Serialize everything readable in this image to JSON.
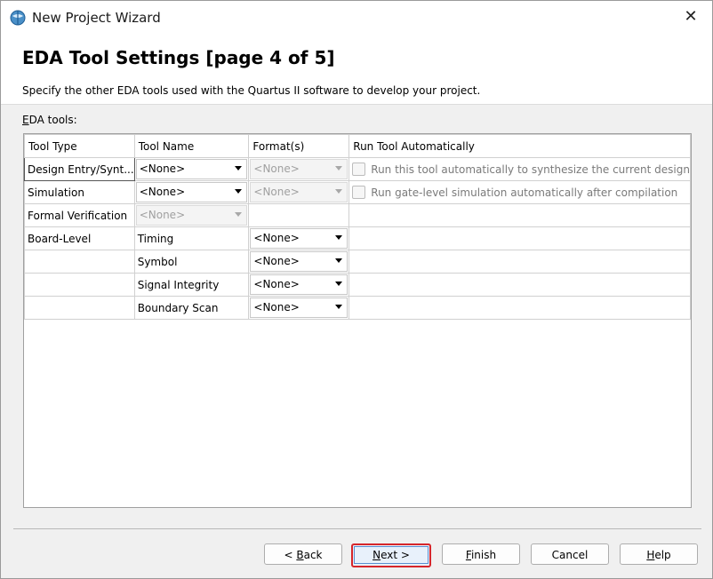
{
  "window": {
    "title": "New Project Wizard"
  },
  "header": {
    "heading": "EDA Tool Settings [page 4 of 5]",
    "description": "Specify the other EDA tools used with the Quartus II software to develop your project."
  },
  "eda_tools": {
    "label_accel": "E",
    "label_rest": "DA tools:",
    "columns": [
      "Tool Type",
      "Tool Name",
      "Format(s)",
      "Run Tool Automatically"
    ],
    "rows": [
      {
        "type": "Design Entry/Synt...",
        "tool": "<None>",
        "format": "<None>",
        "format_disabled": true,
        "auto": "Run this tool automatically to synthesize the current design"
      },
      {
        "type": "Simulation",
        "tool": "<None>",
        "format": "<None>",
        "format_disabled": true,
        "auto": "Run gate-level simulation automatically after compilation"
      },
      {
        "type": "Formal Verification",
        "tool": "<None>",
        "tool_disabled": true
      },
      {
        "type": "Board-Level",
        "tool": "Timing",
        "format": "<None>"
      },
      {
        "type": "",
        "tool": "Symbol",
        "format": "<None>"
      },
      {
        "type": "",
        "tool": "Signal Integrity",
        "format": "<None>"
      },
      {
        "type": "",
        "tool": "Boundary Scan",
        "format": "<None>"
      }
    ]
  },
  "buttons": {
    "back": {
      "accel": "B",
      "pre": "< ",
      "post": "ack"
    },
    "next": {
      "accel": "N",
      "post": "ext >"
    },
    "finish": {
      "accel": "F",
      "post": "inish"
    },
    "cancel": {
      "label": "Cancel"
    },
    "help": {
      "accel": "H",
      "post": "elp"
    }
  },
  "colors": {
    "highlight_border": "#d6262b",
    "title_bg": "#ffffff",
    "dialog_bg": "#f0f0f0"
  }
}
